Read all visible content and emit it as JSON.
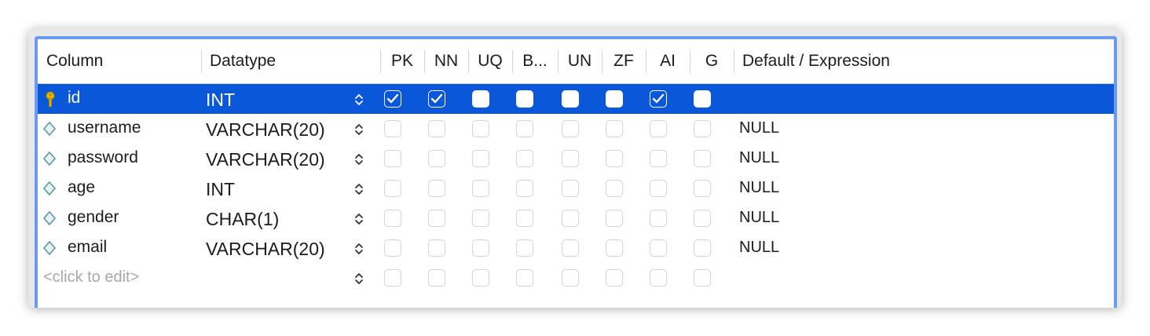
{
  "table": {
    "columns": [
      {
        "key": "column",
        "label": "Column"
      },
      {
        "key": "datatype",
        "label": "Datatype"
      },
      {
        "key": "pk",
        "label": "PK"
      },
      {
        "key": "nn",
        "label": "NN"
      },
      {
        "key": "uq",
        "label": "UQ"
      },
      {
        "key": "b",
        "label": "B..."
      },
      {
        "key": "un",
        "label": "UN"
      },
      {
        "key": "zf",
        "label": "ZF"
      },
      {
        "key": "ai",
        "label": "AI"
      },
      {
        "key": "g",
        "label": "G"
      },
      {
        "key": "default",
        "label": "Default / Expression"
      }
    ],
    "rows": [
      {
        "name": "id",
        "icon": "primary-key-icon",
        "type": "INT",
        "flags": [
          true,
          true,
          false,
          false,
          false,
          false,
          true,
          false
        ],
        "default": "",
        "selected": true
      },
      {
        "name": "username",
        "icon": "column-diamond-icon",
        "type": "VARCHAR(20)",
        "flags": [
          false,
          false,
          false,
          false,
          false,
          false,
          false,
          false
        ],
        "default": "NULL",
        "selected": false
      },
      {
        "name": "password",
        "icon": "column-diamond-icon",
        "type": "VARCHAR(20)",
        "flags": [
          false,
          false,
          false,
          false,
          false,
          false,
          false,
          false
        ],
        "default": "NULL",
        "selected": false
      },
      {
        "name": "age",
        "icon": "column-diamond-icon",
        "type": "INT",
        "flags": [
          false,
          false,
          false,
          false,
          false,
          false,
          false,
          false
        ],
        "default": "NULL",
        "selected": false
      },
      {
        "name": "gender",
        "icon": "column-diamond-icon",
        "type": "CHAR(1)",
        "flags": [
          false,
          false,
          false,
          false,
          false,
          false,
          false,
          false
        ],
        "default": "NULL",
        "selected": false
      },
      {
        "name": "email",
        "icon": "column-diamond-icon",
        "type": "VARCHAR(20)",
        "flags": [
          false,
          false,
          false,
          false,
          false,
          false,
          false,
          false
        ],
        "default": "NULL",
        "selected": false
      }
    ],
    "new_row": {
      "placeholder": "<click to edit>",
      "flags": [
        false,
        false,
        false,
        false,
        false,
        false,
        false,
        false
      ]
    },
    "colors": {
      "selection": "#0b57d9",
      "frame": "#6b9bf0",
      "check": "#0b57d9"
    }
  }
}
